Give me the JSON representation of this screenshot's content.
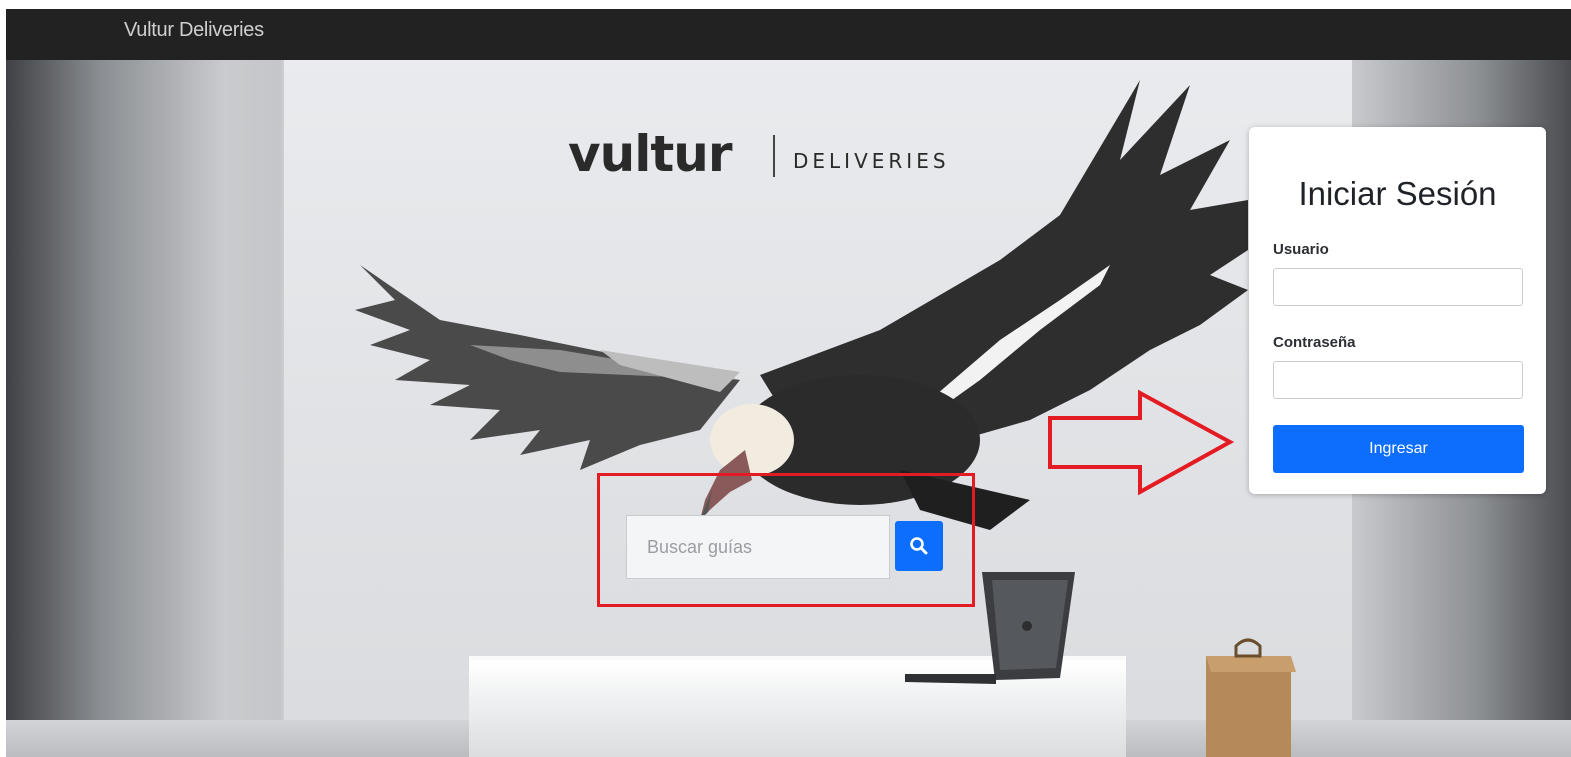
{
  "navbar": {
    "brand": "Vultur Deliveries"
  },
  "hero": {
    "logo_word": "vultur",
    "logo_sub": "DELIVERIES"
  },
  "search": {
    "placeholder": "Buscar guías",
    "icon": "search-icon"
  },
  "login": {
    "title": "Iniciar Sesión",
    "username_label": "Usuario",
    "username_value": "",
    "password_label": "Contraseña",
    "password_value": "",
    "submit_label": "Ingresar"
  },
  "annotations": {
    "highlight_color": "#e31b23"
  },
  "colors": {
    "navbar": "#222222",
    "primary": "#0d6efd"
  }
}
